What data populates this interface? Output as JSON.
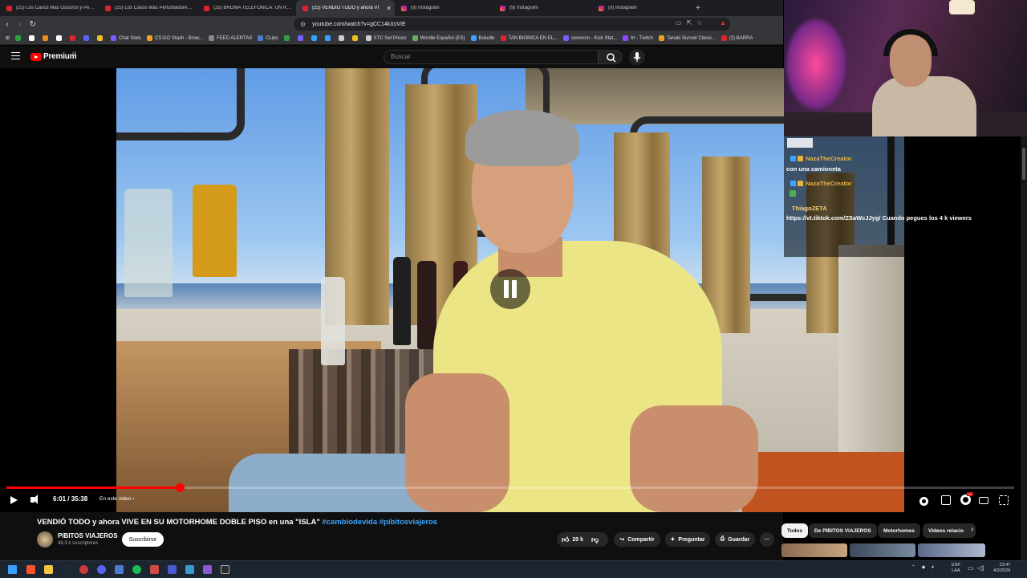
{
  "browser": {
    "tabs": [
      {
        "label": "(25) Los Casos Más Oscuros y Pertur",
        "kind": "yt"
      },
      {
        "label": "(25) Los Casos Más Perturbadores D",
        "kind": "yt"
      },
      {
        "label": "(25) BROMA TELEFONICA: UN REMI",
        "kind": "yt"
      },
      {
        "label": "(25) VENDIÓ TODO y ahora VI",
        "kind": "yt"
      },
      {
        "label": "(9) Instagram",
        "kind": "ig"
      },
      {
        "label": "(9) Instagram",
        "kind": "ig"
      },
      {
        "label": "(9) Instagram",
        "kind": "ig"
      }
    ],
    "active_tab_index": 3,
    "new_tab_label": "+",
    "url": "youtube.com/watch?v=gCC14kXsVIE",
    "bookmarks": [
      {
        "label": "",
        "color": "#2ea043"
      },
      {
        "label": "",
        "color": "#ffffff"
      },
      {
        "label": "",
        "color": "#f08a24"
      },
      {
        "label": "",
        "color": "#ffffff"
      },
      {
        "label": "",
        "color": "#e0212e"
      },
      {
        "label": "",
        "color": "#5865f2"
      },
      {
        "label": "",
        "color": "#f0c020"
      },
      {
        "label": "Chat Stats",
        "color": "#7c5cff"
      },
      {
        "label": "CS:GO Stash - Brow...",
        "color": "#f0a020"
      },
      {
        "label": "FEED ALERTAS",
        "color": "#888888"
      },
      {
        "label": "CLips",
        "color": "#4a7bd0"
      },
      {
        "label": "",
        "color": "#2ea043"
      },
      {
        "label": "",
        "color": "#7c5cff"
      },
      {
        "label": "",
        "color": "#3aa0ff"
      },
      {
        "label": "",
        "color": "#3aa0ff"
      },
      {
        "label": "",
        "color": "#cccccc"
      },
      {
        "label": "",
        "color": "#f0c020"
      },
      {
        "label": "STC Set Prices",
        "color": "#cccccc"
      },
      {
        "label": "Wordle Español (ES)",
        "color": "#6aaa64"
      },
      {
        "label": "Boludle",
        "color": "#3aa0ff"
      },
      {
        "label": "TAN BIONICA EN EL...",
        "color": "#e0212e"
      },
      {
        "label": "sioneron - Kick Stat...",
        "color": "#7c5cff"
      },
      {
        "label": "trr - Twitch",
        "color": "#9146ff"
      },
      {
        "label": "Tanuki Sunset Classi...",
        "color": "#f0a020"
      },
      {
        "label": "(2) BARRA",
        "color": "#e0212e"
      }
    ]
  },
  "youtube": {
    "brand": "Premium",
    "region": "AR",
    "search_placeholder": "Buscar",
    "player": {
      "current_time": "6:01",
      "duration": "35:38",
      "progress_fraction": 0.169,
      "chapter_label": "En este video",
      "hd_badge": "HD"
    },
    "video": {
      "title_main": "VENDIÓ TODO y ahora VIVE EN SU MOTORHOME DOBLE PISO en una \"ISLA\"",
      "hashtags": "#cambiodevida #pibitosviajeros",
      "channel_name": "PIBITOS VIAJEROS",
      "subscribers": "48.3 k suscriptores",
      "subscribe_label": "Suscribirse",
      "likes": "20 k",
      "share_label": "Compartir",
      "ask_label": "Preguntar",
      "save_label": "Guardar",
      "more_label": "···"
    },
    "chips": [
      "Todos",
      "De PIBITOS VIAJEROS",
      "Motorhomes",
      "Videos relacio"
    ]
  },
  "chat": {
    "messages": [
      {
        "user": "NazaTheCreator",
        "text": "con una camioneta"
      },
      {
        "user": "NazaTheCreator",
        "text": ""
      },
      {
        "user": "ThiagoZETA",
        "text": "https://vt.tiktok.com/ZSaWcJJyg/ Cuando pegues los 4 k viewers"
      }
    ]
  },
  "taskbar": {
    "lang_line1": "ESP",
    "lang_line2": "LAA",
    "time": "23:47",
    "date": "4/2/2026"
  },
  "colors": {
    "youtube_red": "#ff0000",
    "link_blue": "#3ea6ff",
    "chat_name": "#e8b43c"
  }
}
